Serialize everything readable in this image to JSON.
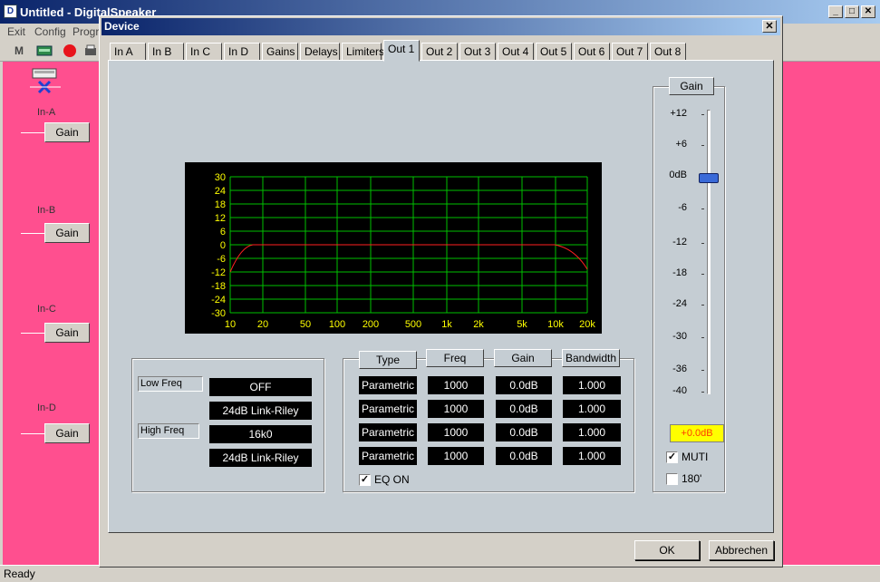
{
  "main_window": {
    "title": "Untitled - DigitalSpeaker",
    "app_icon_glyph": "D",
    "min_glyph": "_",
    "max_glyph": "□",
    "close_glyph": "✕",
    "menu": [
      "Exit",
      "Config",
      "Progr"
    ],
    "toolbar_first_label": "M",
    "inputs": [
      {
        "label": "In-A",
        "block": "Gain"
      },
      {
        "label": "In-B",
        "block": "Gain"
      },
      {
        "label": "In-C",
        "block": "Gain"
      },
      {
        "label": "In-D",
        "block": "Gain"
      }
    ],
    "status": "Ready"
  },
  "dialog": {
    "title": "Device",
    "close_glyph": "✕",
    "tabs": [
      "In A",
      "In B",
      "In C",
      "In D",
      "Gains",
      "Delays",
      "Limiters",
      "Out 1",
      "Out 2",
      "Out 3",
      "Out 4",
      "Out 5",
      "Out 6",
      "Out 7",
      "Out 8"
    ],
    "active_tab": "Out 1",
    "graph": {
      "y_labels": [
        "30",
        "24",
        "18",
        "12",
        "6",
        "0",
        "-6",
        "-12",
        "-18",
        "-24",
        "-30"
      ],
      "x_labels": [
        "10",
        "20",
        "50",
        "100",
        "200",
        "500",
        "1k",
        "2k",
        "5k",
        "10k",
        "20k"
      ],
      "grid_color": "#00c000",
      "label_color": "#ffff00",
      "curve_color": "#ff2020"
    },
    "crossover": {
      "low_freq_label": "Low Freq",
      "low_freq_value": "OFF",
      "low_filter": "24dB Link-Riley",
      "high_freq_label": "High Freq",
      "high_freq_value": "16k0",
      "high_filter": "24dB Link-Riley"
    },
    "eq": {
      "headers": {
        "type": "Type",
        "freq": "Freq",
        "gain": "Gain",
        "bandwidth": "Bandwidth"
      },
      "bands": [
        {
          "type": "Parametric",
          "freq": "1000",
          "gain": "0.0dB",
          "bw": "1.000"
        },
        {
          "type": "Parametric",
          "freq": "1000",
          "gain": "0.0dB",
          "bw": "1.000"
        },
        {
          "type": "Parametric",
          "freq": "1000",
          "gain": "0.0dB",
          "bw": "1.000"
        },
        {
          "type": "Parametric",
          "freq": "1000",
          "gain": "0.0dB",
          "bw": "1.000"
        }
      ],
      "eq_on_label": "EQ ON",
      "eq_on_checked": true
    },
    "gain": {
      "title": "Gain",
      "scale": [
        "+12",
        "+6",
        "0dB",
        "-6",
        "-12",
        "-18",
        "-24",
        "-30",
        "-36",
        "-40"
      ],
      "value_db": 0.0,
      "readout": "+0.0dB",
      "muti_label": "MUTI",
      "muti_checked": true,
      "deg_label": "180'",
      "deg_checked": false
    },
    "ok_label": "OK",
    "cancel_label": "Abbrechen"
  }
}
